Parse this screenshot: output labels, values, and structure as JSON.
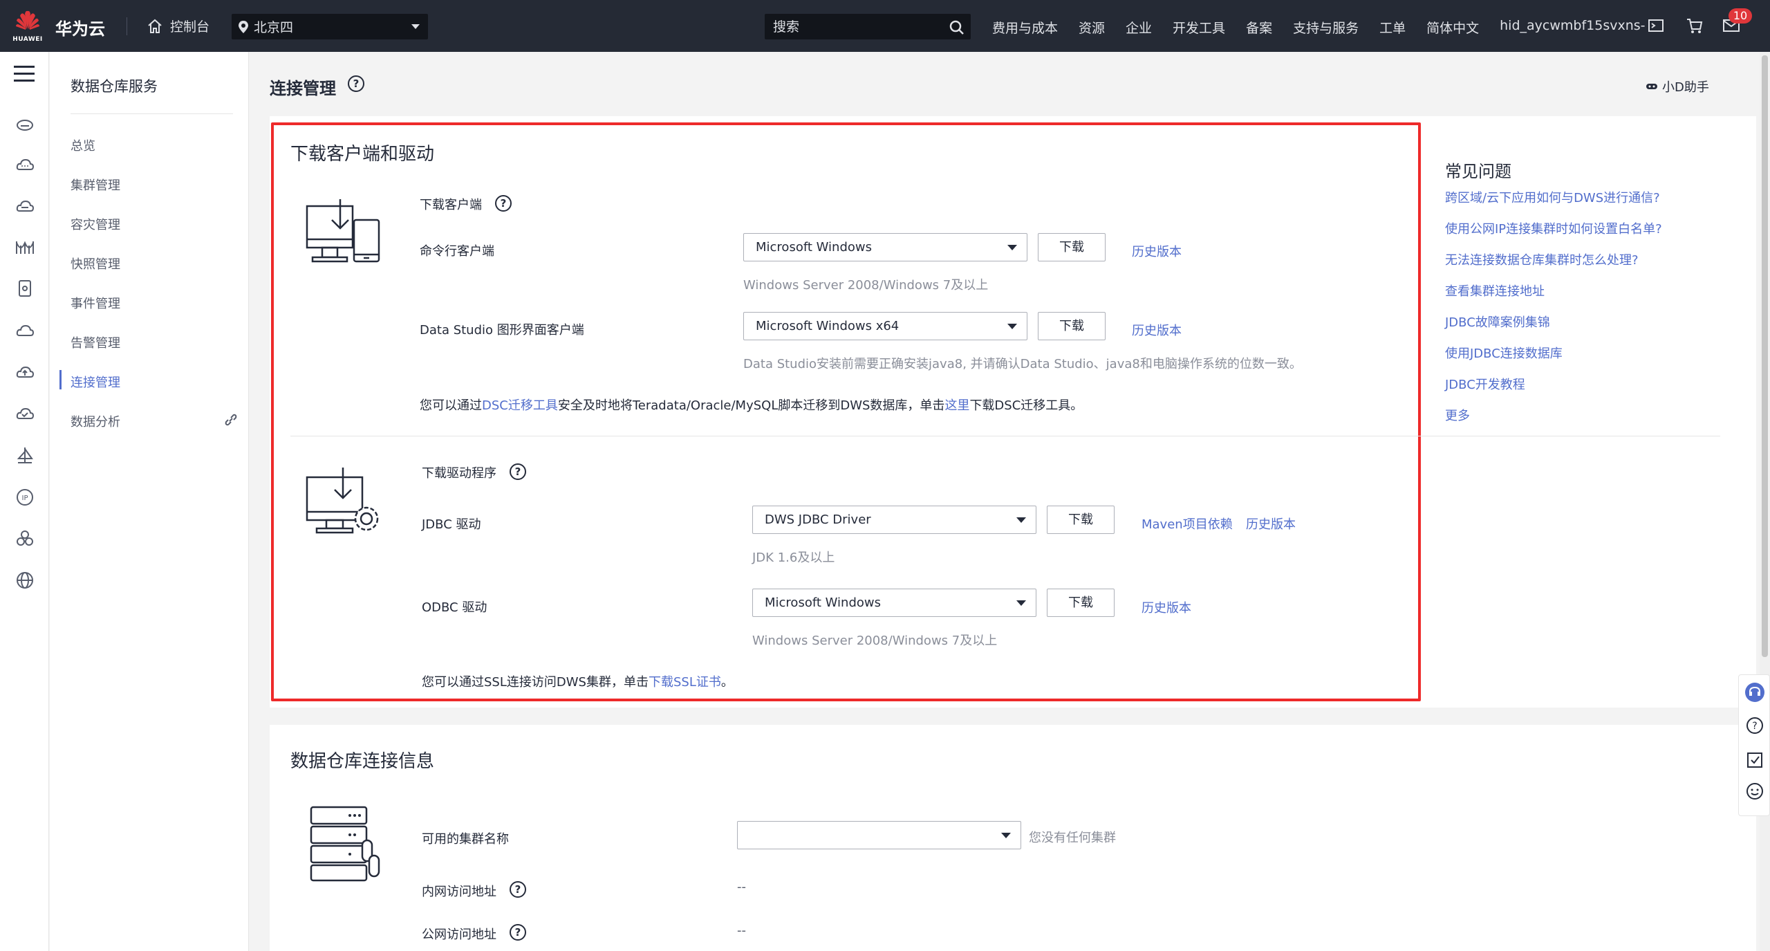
{
  "header": {
    "logo_text": "HUAWEI",
    "brand": "华为云",
    "console": "控制台",
    "region": "北京四",
    "search_placeholder": "搜索",
    "nav": [
      "费用与成本",
      "资源",
      "企业",
      "开发工具",
      "备案",
      "支持与服务",
      "工单",
      "简体中文",
      "hid_aycwmbf15svxns-"
    ],
    "badge_count": "10"
  },
  "sidebar": {
    "title": "数据仓库服务",
    "items": [
      "总览",
      "集群管理",
      "容灾管理",
      "快照管理",
      "事件管理",
      "告警管理",
      "连接管理",
      "数据分析"
    ],
    "active": "连接管理"
  },
  "page": {
    "title": "连接管理",
    "assistant": "小D助手"
  },
  "download": {
    "title": "下载客户端和驱动",
    "client_section": "下载客户端",
    "cli_label": "命令行客户端",
    "cli_select": "Microsoft Windows",
    "cli_hint": "Windows Server 2008/Windows 7及以上",
    "ds_label": "Data Studio 图形界面客户端",
    "ds_select": "Microsoft Windows x64",
    "ds_hint": "Data Studio安装前需要正确安装java8, 并请确认Data Studio、java8和电脑操作系统的位数一致。",
    "download_btn": "下载",
    "history": "历史版本",
    "dsc_pre": "您可以通过",
    "dsc_link": "DSC迁移工具",
    "dsc_mid": "安全及时地将Teradata/Oracle/MySQL脚本迁移到DWS数据库，单击",
    "dsc_here": "这里",
    "dsc_post": "下载DSC迁移工具。",
    "driver_section": "下载驱动程序",
    "jdbc_label": "JDBC 驱动",
    "jdbc_select": "DWS JDBC Driver",
    "jdbc_hint": "JDK 1.6及以上",
    "maven": "Maven项目依赖",
    "odbc_label": "ODBC 驱动",
    "odbc_select": "Microsoft Windows",
    "odbc_hint": "Windows Server 2008/Windows 7及以上",
    "ssl_pre": "您可以通过SSL连接访问DWS集群，单击",
    "ssl_link": "下载SSL证书",
    "ssl_post": "。"
  },
  "faq": {
    "title": "常见问题",
    "items": [
      "跨区域/云下应用如何与DWS进行通信?",
      "使用公网IP连接集群时如何设置白名单?",
      "无法连接数据仓库集群时怎么处理?",
      "查看集群连接地址",
      "JDBC故障案例集锦",
      "使用JDBC连接数据库",
      "JDBC开发教程",
      "更多"
    ]
  },
  "conn_info": {
    "title": "数据仓库连接信息",
    "cluster_label": "可用的集群名称",
    "cluster_value": "",
    "cluster_hint": "您没有任何集群",
    "private_label": "内网访问地址",
    "private_value": "--",
    "public_label": "公网访问地址",
    "public_value": "--"
  }
}
